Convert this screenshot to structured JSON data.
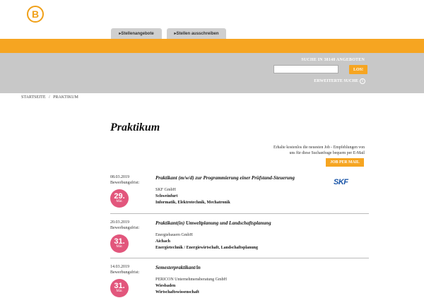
{
  "logo": {
    "letter": "B"
  },
  "tabs": [
    {
      "label": "▸Stellenangebote"
    },
    {
      "label": "▸Stellen ausschreiben"
    }
  ],
  "search": {
    "label": "SUCHE IN 38148 ANGEBOTEN",
    "input_value": "",
    "placeholder": "",
    "button": "LOS!",
    "advanced": "ERWEITERTE SUCHE"
  },
  "breadcrumb": {
    "home": "STARTSEITE",
    "separator": "/",
    "current": "PRAKTIKUM"
  },
  "page_title": "Praktikum",
  "alert": {
    "line1": "Erhalte kostenlos die neuesten Job - Empfehlungen von",
    "line2": "uns für diese Suchanfrage bequem per E-Mail",
    "button": "JOB PER MAIL"
  },
  "deadline_label": "Bewerbungsfrist:",
  "jobs": [
    {
      "date": "08.03.2019",
      "day": "29.",
      "month": "Mär.",
      "title": "Praktikant (m/w/d) zur Programmierung einer Prüfstand-Steuerung",
      "company": "SKF GmbH",
      "city": "Schweinfurt",
      "field": "Informatik, Elektrotechnik, Mechatronik",
      "company_logo": "SKF"
    },
    {
      "date": "20.03.2019",
      "day": "31.",
      "month": "Mär.",
      "title": "Praktikant(in) Umweltplanung und Landschaftsplanung",
      "company": "Energiebauern GmbH",
      "city": "Aichach",
      "field": "Energietechnik / Energiewirtschaft, Landschaftsplanung"
    },
    {
      "date": "14.03.2019",
      "day": "31.",
      "month": "Mär.",
      "title": "Semesterpraktikant/in",
      "company": "PERICON Unternehmensberatung GmbH",
      "city": "Wiesbaden",
      "field": "Wirtschaftswissenschaft"
    }
  ],
  "colors": {
    "accent": "#f6a521",
    "badge": "#e2567c",
    "band": "#c8c8c8",
    "brand_skf": "#1a55a8"
  },
  "icons": {
    "advanced": "info-circle-icon"
  }
}
